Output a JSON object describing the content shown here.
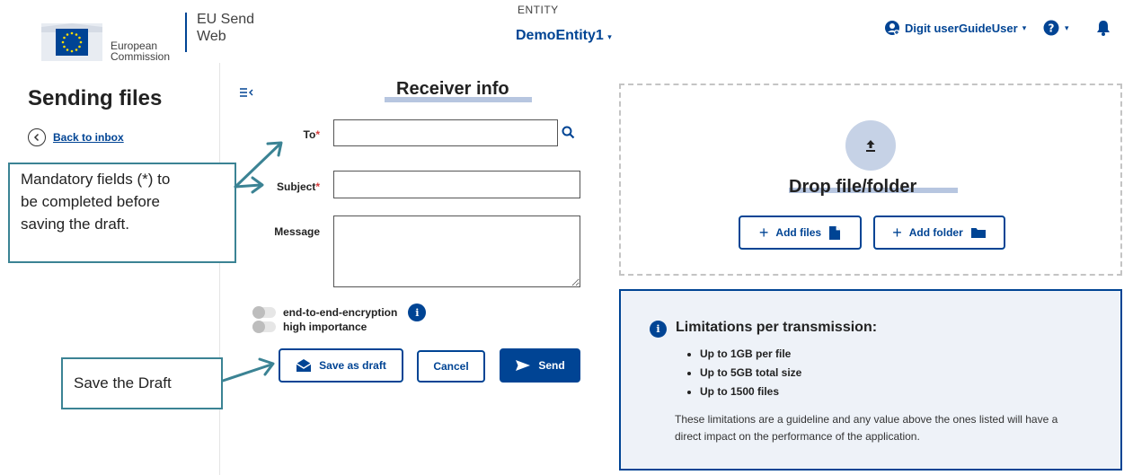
{
  "header": {
    "logo_line1": "European",
    "logo_line2": "Commission",
    "app_name_line1": "EU Send",
    "app_name_line2": "Web",
    "entity_label": "ENTITY",
    "entity_value": "DemoEntity1",
    "user_name": "Digit userGuideUser",
    "colors": {
      "brand": "#004494"
    }
  },
  "sidebar": {
    "page_title": "Sending files",
    "back_link": "Back to inbox"
  },
  "form": {
    "section_title": "Receiver info",
    "to_label": "To",
    "subject_label": "Subject",
    "message_label": "Message",
    "required_mark": "*",
    "to_value": "",
    "subject_value": "",
    "message_value": "",
    "toggles": [
      {
        "label": "end-to-end-encryption",
        "on": false
      },
      {
        "label": "high importance",
        "on": false
      }
    ],
    "buttons": {
      "save_draft": "Save as draft",
      "cancel": "Cancel",
      "send": "Send"
    }
  },
  "upload": {
    "title": "Drop file/folder",
    "add_files": "Add files",
    "add_folder": "Add folder"
  },
  "limits": {
    "title": "Limitations per transmission:",
    "items": [
      "Up to 1GB per file",
      "Up to 5GB total size",
      "Up to 1500 files"
    ],
    "note": "These limitations are a guideline and any value above the ones listed will have a direct impact on the performance of the application."
  },
  "annotations": {
    "mandatory_line1": "Mandatory fields (*) to",
    "mandatory_line2": "be completed before",
    "mandatory_line3": "saving the draft.",
    "save_draft": "Save the Draft",
    "callout_color": "#3b8394"
  }
}
